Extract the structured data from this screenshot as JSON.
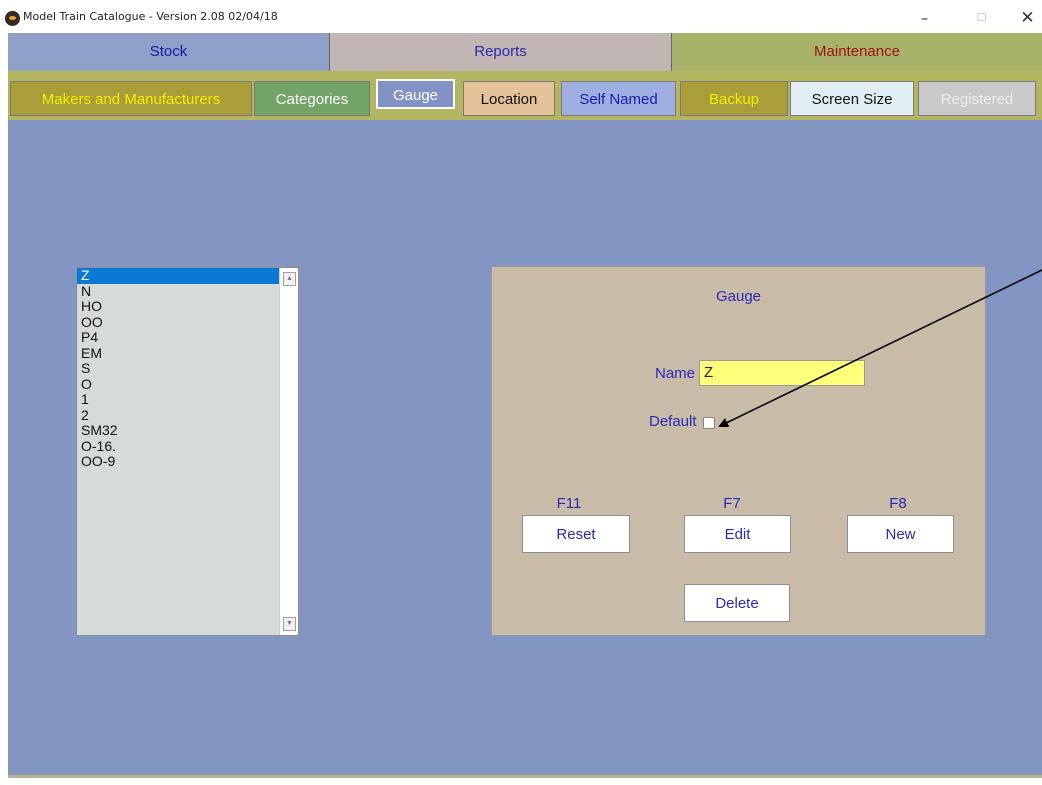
{
  "window": {
    "title": "Model Train Catalogue - Version 2.08  02/04/18",
    "controls": {
      "minimize": "–",
      "maximize": "☐",
      "close": "✕"
    }
  },
  "main_tabs": [
    {
      "label": "Stock"
    },
    {
      "label": "Reports"
    },
    {
      "label": "Maintenance",
      "selected": true
    }
  ],
  "sub_tabs": [
    {
      "label": "Makers and Manufacturers"
    },
    {
      "label": "Categories"
    },
    {
      "label": "Gauge",
      "selected": true
    },
    {
      "label": "Location"
    },
    {
      "label": "Self Named"
    },
    {
      "label": "Backup"
    },
    {
      "label": "Screen Size"
    },
    {
      "label": "Registered",
      "disabled": true
    }
  ],
  "gauge_list": {
    "items": [
      "Z",
      "N",
      "HO",
      "OO",
      "P4",
      "EM",
      "S",
      "O",
      "1",
      "2",
      "SM32",
      "O-16.",
      "OO-9"
    ],
    "selected": "Z"
  },
  "panel": {
    "title": "Gauge",
    "name_label": "Name",
    "name_value": "Z",
    "default_label": "Default",
    "default_checked": false,
    "buttons": {
      "reset": {
        "key": "F11",
        "label": "Reset"
      },
      "edit": {
        "key": "F7",
        "label": "Edit"
      },
      "new": {
        "key": "F8",
        "label": "New"
      },
      "delete": {
        "label": "Delete"
      }
    }
  },
  "colors": {
    "content_bg": "#8395c3",
    "panel_bg": "#c8bca8",
    "label_text": "#2a2ab8",
    "name_field_bg": "#ffff7a",
    "selected_item": "#0a78d7"
  }
}
